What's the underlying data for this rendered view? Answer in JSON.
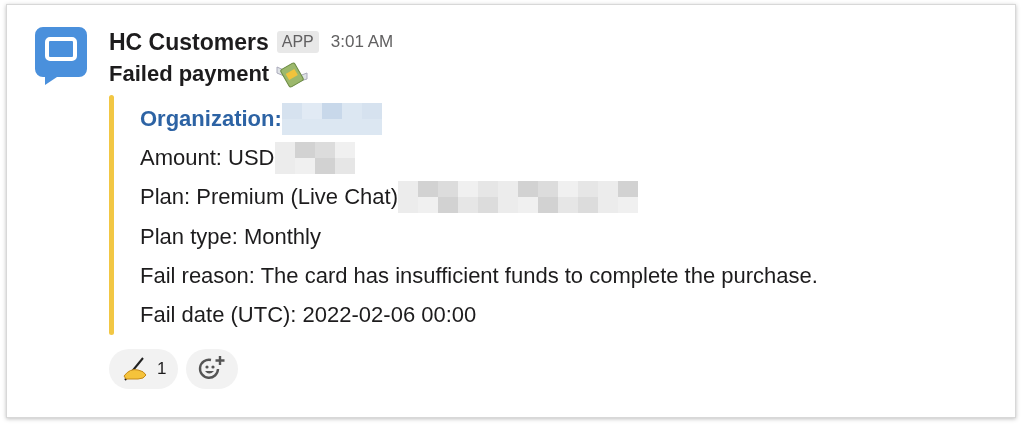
{
  "message": {
    "sender": "HC Customers",
    "badge": "APP",
    "time": "3:01 AM",
    "text": "Failed payment"
  },
  "attachment": {
    "color": "#f2c744",
    "fields": [
      {
        "kind": "heading",
        "text": "Organization:",
        "redacted": true
      },
      {
        "kind": "plain",
        "text": "Amount: USD",
        "redacted": true
      },
      {
        "kind": "plain",
        "text": "Plan: Premium (Live Chat)",
        "redacted": true
      },
      {
        "kind": "plain",
        "text": "Plan type: Monthly"
      },
      {
        "kind": "plain",
        "text": "Fail reason: The card has insufficient funds to complete the purchase."
      },
      {
        "kind": "plain",
        "text": "Fail date (UTC): 2022-02-06 00:00"
      }
    ]
  },
  "reactions": [
    {
      "kind": "emoji",
      "count": "1"
    },
    {
      "kind": "add"
    }
  ]
}
